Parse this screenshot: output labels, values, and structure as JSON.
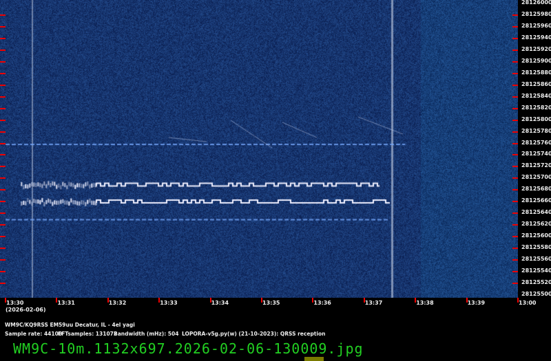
{
  "chart_data": {
    "type": "heatmap",
    "title": "QRSS spectrogram",
    "x_ticks": [
      "13:30",
      "13:31",
      "13:32",
      "13:33",
      "13:34",
      "13:35",
      "13:36",
      "13:37",
      "13:38",
      "13:39",
      "13:00"
    ],
    "x_date": "(2026-02-06)",
    "y_ticks": [
      "28126000",
      "28125980",
      "28125960",
      "28125940",
      "28125920",
      "28125900",
      "28125880",
      "28125860",
      "28125840",
      "28125820",
      "28125800",
      "28125780",
      "28125760",
      "28125740",
      "28125720",
      "28125700",
      "28125680",
      "28125660",
      "28125640",
      "28125620",
      "28125600",
      "28125580",
      "28125560",
      "28125540",
      "28125520",
      "28125500"
    ],
    "ylim": [
      28125500,
      28126000
    ],
    "xlim_minutes": [
      0,
      10
    ],
    "signals": [
      {
        "name": "fsk-upper",
        "freq": 28125687,
        "start_min": 0.3,
        "end_min": 7.3
      },
      {
        "name": "fsk-lower",
        "freq": 28125658,
        "start_min": 0.3,
        "end_min": 7.5
      },
      {
        "name": "carrier-1",
        "freq": 28125757,
        "start_min": 0,
        "end_min": 7.8
      },
      {
        "name": "carrier-2",
        "freq": 28125628,
        "start_min": 0,
        "end_min": 7.5
      }
    ],
    "colors": {
      "background": "#132a60",
      "signal": "#f0f0ff",
      "tick": "#e00000"
    }
  },
  "footer": {
    "station": "WM9C/KQ9RSS EM59uu Decatur, IL - 4el yagi",
    "sample_rate": "Sample rate: 44100",
    "fft": "FFTsamples: 131072",
    "bandwidth": "Bandwidth (mHz): 504",
    "software": "LOPORA-v5g.py(w) (21-10-2023): QRSS reception",
    "filename": "WM9C-10m.1132x697.2026-02-06-130009.jpg"
  }
}
